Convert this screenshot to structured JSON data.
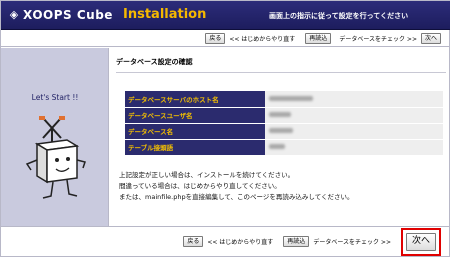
{
  "header": {
    "logo_text": "XOOPS Cube",
    "install_title": "Installation",
    "message": "画面上の指示に従って設定を行ってください"
  },
  "nav": {
    "back_label": "戻る",
    "back_text": "<< はじめからやり直す",
    "reload_label": "再読込",
    "check_text": "データベースをチェック >>",
    "next_label": "次へ"
  },
  "sidebar": {
    "lets_start": "Let's Start !!"
  },
  "main": {
    "section_title": "データベース設定の確認",
    "rows": [
      {
        "label": "データベースサーバのホスト名",
        "value_width": 44
      },
      {
        "label": "データベースユーザ名",
        "value_width": 22
      },
      {
        "label": "データベース名",
        "value_width": 24
      },
      {
        "label": "テーブル接頭語",
        "value_width": 16
      }
    ],
    "notes": [
      "上記設定が正しい場合は、インストールを続けてください。",
      "間違っている場合は、はじめからやり直してください。",
      "または、mainfile.phpを直接編集して、このページを再読み込みしてください。"
    ]
  }
}
